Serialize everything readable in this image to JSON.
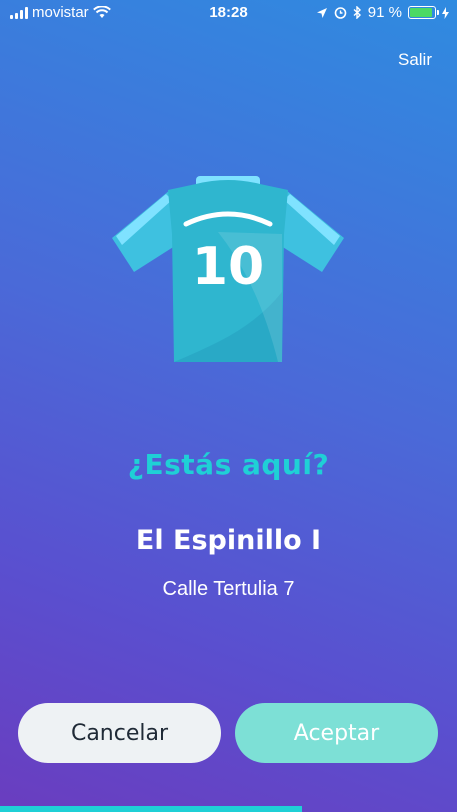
{
  "status_bar": {
    "carrier": "movistar",
    "time": "18:28",
    "battery_text": "91 %",
    "battery_level": 0.91,
    "icons": [
      "signal-icon",
      "wifi-icon",
      "location-icon",
      "alarm-icon",
      "bluetooth-icon",
      "battery-icon",
      "charging-icon"
    ]
  },
  "header": {
    "exit_label": "Salir"
  },
  "jersey": {
    "number": "10",
    "icon": "jersey-icon"
  },
  "confirm": {
    "question": "¿Estás aquí?",
    "place_name": "El Espinillo I",
    "address": "Calle Tertulia 7"
  },
  "actions": {
    "cancel_label": "Cancelar",
    "accept_label": "Aceptar"
  },
  "progress": {
    "fraction": 0.66
  },
  "colors": {
    "accent": "#1fd0d6",
    "accept_button": "#7de0d6",
    "cancel_button": "#eef2f4",
    "battery": "#4cd964"
  }
}
